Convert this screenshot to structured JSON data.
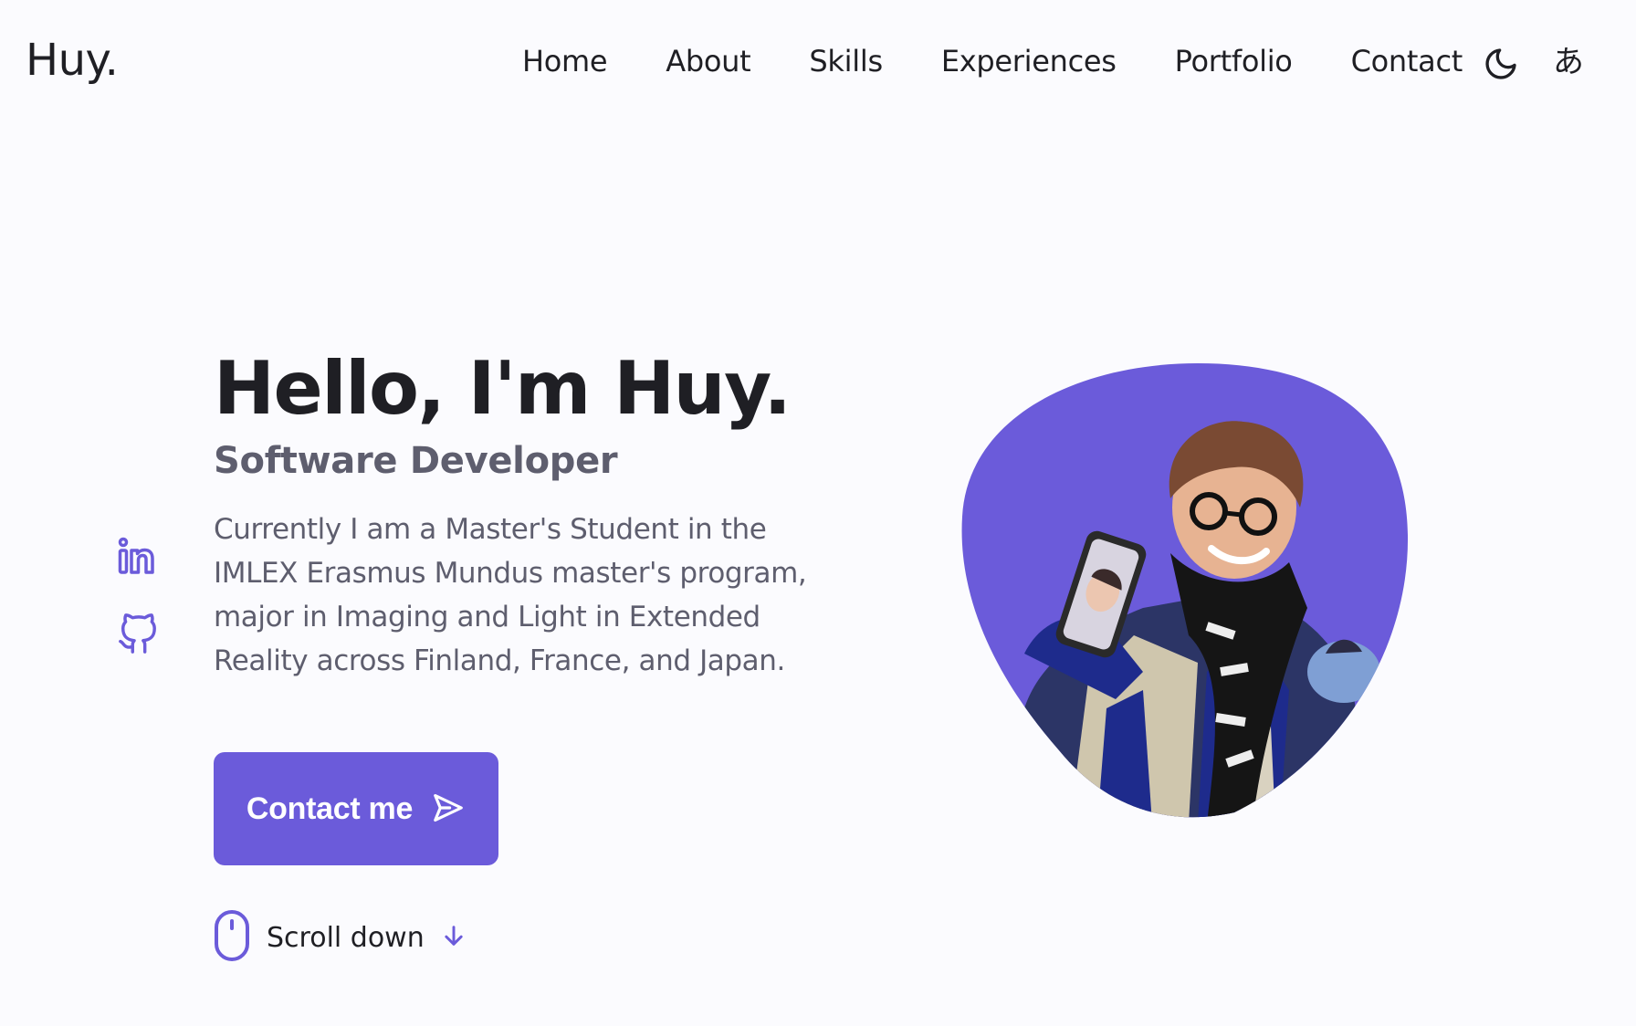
{
  "header": {
    "logo": "Huy.",
    "nav": [
      {
        "label": "Home"
      },
      {
        "label": "About"
      },
      {
        "label": "Skills"
      },
      {
        "label": "Experiences"
      },
      {
        "label": "Portfolio"
      },
      {
        "label": "Contact"
      }
    ],
    "theme_icon": "moon-icon",
    "language_glyph": "あ"
  },
  "social": [
    {
      "icon": "linkedin-icon"
    },
    {
      "icon": "github-icon"
    }
  ],
  "hero": {
    "title": "Hello, I'm Huy.",
    "subtitle": "Software Developer",
    "description": "Currently I am a Master's Student in the IMLEX Erasmus Mundus master's program, major in Imaging and Light in Extended Reality across Finland, France, and Japan.",
    "contact_button": "Contact me",
    "scroll_label": "Scroll down"
  },
  "colors": {
    "accent": "#6b5bda",
    "text": "#1f1f24",
    "muted": "#5e5e6e",
    "background": "#fbfbfe"
  }
}
